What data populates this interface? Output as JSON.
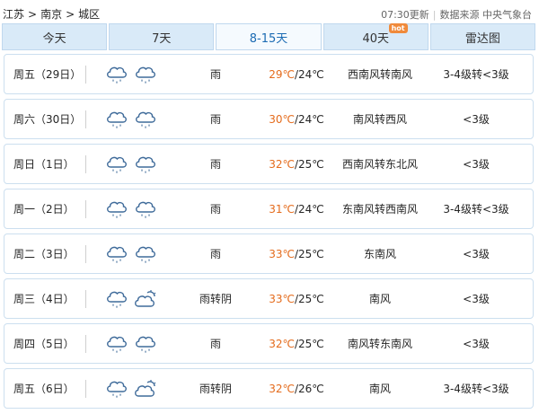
{
  "breadcrumb": [
    "江苏",
    "南京",
    "城区"
  ],
  "meta": {
    "update": "07:30更新",
    "source": "数据来源 中央气象台"
  },
  "tabs": [
    {
      "label": "今天",
      "active": false,
      "badge": ""
    },
    {
      "label": "7天",
      "active": false,
      "badge": ""
    },
    {
      "label": "8-15天",
      "active": true,
      "badge": ""
    },
    {
      "label": "40天",
      "active": false,
      "badge": "hot"
    },
    {
      "label": "雷达图",
      "active": false,
      "badge": ""
    }
  ],
  "temp_unit": "℃",
  "colors": {
    "high_temp": "#e46b1c",
    "icon_stroke": "#3f6b9a",
    "sun": "#3f6b9a"
  },
  "days": [
    {
      "day": "周五（29日）",
      "icons": [
        "rain-cloud-icon",
        "rain-cloud-icon"
      ],
      "condition": "雨",
      "high": "29",
      "low": "24",
      "wind": "西南风转南风",
      "level": "3-4级转<3级"
    },
    {
      "day": "周六（30日）",
      "icons": [
        "rain-cloud-icon",
        "rain-cloud-icon"
      ],
      "condition": "雨",
      "high": "30",
      "low": "24",
      "wind": "南风转西风",
      "level": "<3级"
    },
    {
      "day": "周日（1日）",
      "icons": [
        "rain-cloud-icon",
        "rain-cloud-icon"
      ],
      "condition": "雨",
      "high": "32",
      "low": "25",
      "wind": "西南风转东北风",
      "level": "<3级"
    },
    {
      "day": "周一（2日）",
      "icons": [
        "rain-cloud-icon",
        "rain-cloud-icon"
      ],
      "condition": "雨",
      "high": "31",
      "low": "24",
      "wind": "东南风转西南风",
      "level": "3-4级转<3级"
    },
    {
      "day": "周二（3日）",
      "icons": [
        "rain-cloud-icon",
        "rain-cloud-icon"
      ],
      "condition": "雨",
      "high": "33",
      "low": "25",
      "wind": "东南风",
      "level": "<3级"
    },
    {
      "day": "周三（4日）",
      "icons": [
        "rain-cloud-icon",
        "overcast-cloud-icon"
      ],
      "condition": "雨转阴",
      "high": "33",
      "low": "25",
      "wind": "南风",
      "level": "<3级"
    },
    {
      "day": "周四（5日）",
      "icons": [
        "rain-cloud-icon",
        "rain-cloud-icon"
      ],
      "condition": "雨",
      "high": "32",
      "low": "25",
      "wind": "南风转东南风",
      "level": "<3级"
    },
    {
      "day": "周五（6日）",
      "icons": [
        "rain-cloud-icon",
        "overcast-cloud-icon"
      ],
      "condition": "雨转阴",
      "high": "32",
      "low": "26",
      "wind": "南风",
      "level": "3-4级转<3级"
    }
  ]
}
